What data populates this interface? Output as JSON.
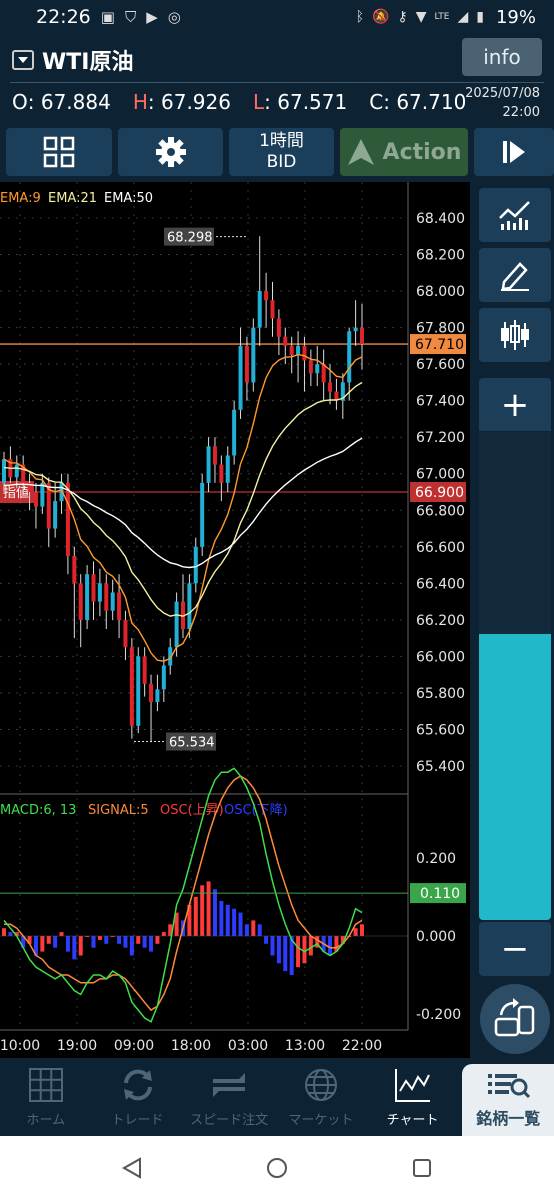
{
  "status_bar": {
    "time": "22:26",
    "battery": "19%",
    "network": "LTE"
  },
  "header": {
    "symbol": "WTI原油",
    "info_label": "info",
    "ohlc": [
      {
        "key": "O",
        "value": "67.884"
      },
      {
        "key": "H",
        "value": "67.926"
      },
      {
        "key": "L",
        "value": "67.571"
      },
      {
        "key": "C",
        "value": "67.710"
      }
    ],
    "date": "2025/07/08",
    "time": "22:00"
  },
  "toolbar": {
    "timeframe_line1": "1時間",
    "timeframe_line2": "BID",
    "action_label": "Action"
  },
  "chart_labels": {
    "ema_legend": [
      {
        "label": "EMA:9",
        "color": "#ff9a2e"
      },
      {
        "label": "EMA:21",
        "color": "#f5f0a0"
      },
      {
        "label": "EMA:50",
        "color": "#ffffff"
      }
    ],
    "limit_order_label": "指値",
    "limit_order_price": "66.900",
    "current_price": "67.710",
    "high_marker": "68.298",
    "low_marker": "65.534",
    "macd_legend": [
      {
        "label": "MACD:6, 13",
        "color": "#3ee04a"
      },
      {
        "label": "SIGNAL:5",
        "color": "#ff8a3a"
      },
      {
        "label": "OSC(上昇)",
        "color": "#ff3b3b"
      },
      {
        "label": "OSC(下降)",
        "color": "#2d3cff"
      }
    ],
    "macd_current": "0.110"
  },
  "chart_data": {
    "type": "candlestick",
    "price_axis": [
      "68.400",
      "68.200",
      "68.000",
      "67.800",
      "67.600",
      "67.400",
      "67.200",
      "67.000",
      "66.800",
      "66.600",
      "66.400",
      "66.200",
      "66.000",
      "65.800",
      "65.600",
      "65.400"
    ],
    "macd_axis": [
      "0.200",
      "0.000",
      "-0.200"
    ],
    "time_axis": [
      "10:00",
      "19:00",
      "09:00",
      "18:00",
      "03:00",
      "13:00",
      "22:00"
    ],
    "ylim": [
      65.4,
      68.4
    ],
    "colors": {
      "up": "#22b0d6",
      "down": "#e0242c"
    }
  },
  "side_panel": {
    "plus": "+",
    "minus": "−"
  },
  "bottom_nav": [
    {
      "label": "ホーム",
      "icon": "grid-icon"
    },
    {
      "label": "トレード",
      "icon": "refresh-icon"
    },
    {
      "label": "スピード注文",
      "icon": "speed-icon"
    },
    {
      "label": "マーケット",
      "icon": "globe-icon"
    },
    {
      "label": "チャート",
      "icon": "chart-icon"
    },
    {
      "label": "銘柄一覧",
      "icon": "list-search-icon"
    }
  ]
}
